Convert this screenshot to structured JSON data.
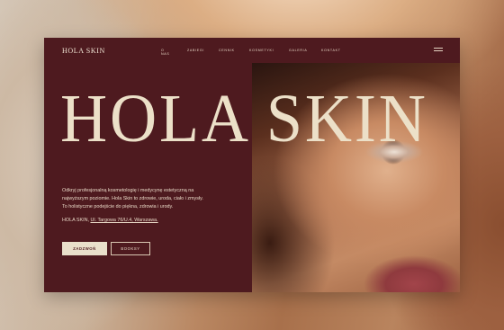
{
  "brand": {
    "logo_text": "HOLA SKIN",
    "hero_title": "HOLA SKIN"
  },
  "nav": {
    "items": [
      "O NAS",
      "ZABIEGI",
      "CENNIK",
      "KOSMETYKI",
      "GALERIA",
      "KONTAKT"
    ],
    "menu_icon": "hamburger-icon"
  },
  "content": {
    "desc_line1": "Odkryj profesjonalną kosmetologię i medycynę estetyczną na",
    "desc_line2": "najwyższym poziomie. Hola Skin to zdrowie, uroda, ciało i zmysły.",
    "desc_line3": "To holistyczne podejście do piękna, zdrowia i urody.",
    "address_prefix": "HOLA SKIN,",
    "address_link": "Ul. Targowa 76/U.4, Warszawa."
  },
  "buttons": {
    "call": "ZADZWOŃ",
    "book": "BOOKSY"
  },
  "colors": {
    "panel": "#4e1a1f",
    "accent_text": "#ece0c8",
    "button_fill": "#eadfca"
  }
}
